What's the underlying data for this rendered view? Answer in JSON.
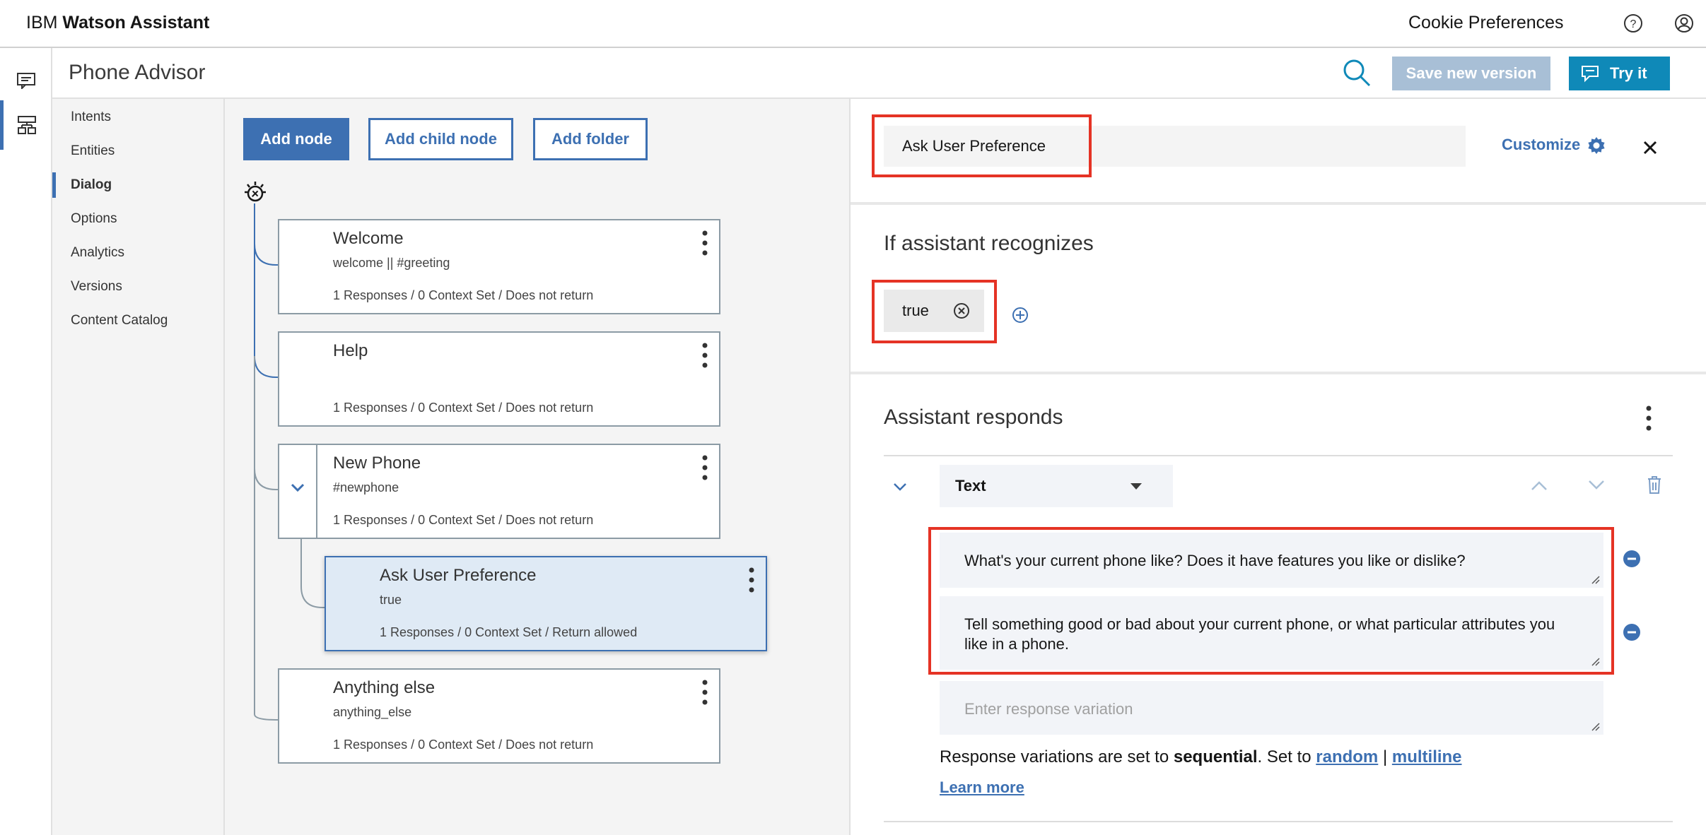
{
  "header": {
    "brand_prefix": "IBM",
    "brand_name": "Watson Assistant",
    "cookie_label": "Cookie Preferences"
  },
  "skill": {
    "title": "Phone Advisor",
    "save_label": "Save new version",
    "try_label": "Try it"
  },
  "subnav": {
    "items": [
      {
        "label": "Intents"
      },
      {
        "label": "Entities"
      },
      {
        "label": "Dialog"
      },
      {
        "label": "Options"
      },
      {
        "label": "Analytics"
      },
      {
        "label": "Versions"
      },
      {
        "label": "Content Catalog"
      }
    ]
  },
  "dialog": {
    "add_node": "Add node",
    "add_child_node": "Add child node",
    "add_folder": "Add folder",
    "nodes": [
      {
        "title": "Welcome",
        "condition": "welcome || #greeting",
        "meta": "1 Responses / 0 Context Set / Does not return"
      },
      {
        "title": "Help",
        "condition": "",
        "meta": "1 Responses / 0 Context Set / Does not return"
      },
      {
        "title": "New Phone",
        "condition": "#newphone",
        "meta": "1 Responses / 0 Context Set / Does not return"
      },
      {
        "title": "Ask User Preference",
        "condition": "true",
        "meta": "1 Responses / 0 Context Set / Return allowed"
      },
      {
        "title": "Anything else",
        "condition": "anything_else",
        "meta": "1 Responses / 0 Context Set / Does not return"
      }
    ]
  },
  "panel": {
    "node_name": "Ask User Preference",
    "customize": "Customize",
    "if_recognizes": "If assistant recognizes",
    "condition_tag": "true",
    "assistant_responds": "Assistant responds",
    "response_type": "Text",
    "responses": [
      "What's your current phone like? Does it have features you like or dislike?",
      "Tell something good or bad about your current phone, or what particular attributes you like in a phone."
    ],
    "variation_placeholder": "Enter response variation",
    "note_prefix": "Response variations are set to ",
    "note_mode": "sequential",
    "note_mid": ". Set to ",
    "note_random": "random",
    "note_sep": " | ",
    "note_multiline": "multiline",
    "learn_more": "Learn more"
  },
  "colors": {
    "accent": "#3d70b2",
    "try_button": "#0f89b8",
    "highlight_red": "#e53325"
  }
}
